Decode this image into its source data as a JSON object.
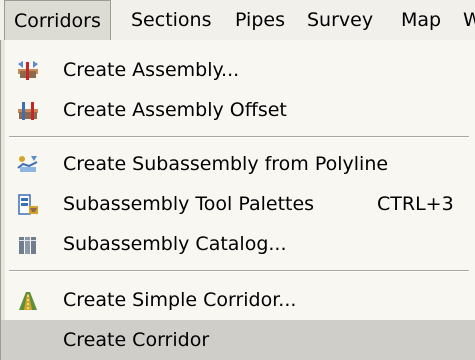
{
  "menubar": {
    "items": [
      {
        "label": "Corridors",
        "active": true
      },
      {
        "label": "Sections"
      },
      {
        "label": "Pipes"
      },
      {
        "label": "Survey"
      },
      {
        "label": "Map"
      },
      {
        "label": "W"
      }
    ]
  },
  "menu": {
    "items": [
      {
        "label": "Create Assembly...",
        "icon": "assembly-icon"
      },
      {
        "label": "Create Assembly Offset",
        "icon": "assembly-offset-icon"
      },
      {
        "label": "Create Subassembly from Polyline",
        "icon": "subassembly-polyline-icon"
      },
      {
        "label": "Subassembly Tool Palettes",
        "shortcut": "CTRL+3",
        "icon": "tool-palettes-icon"
      },
      {
        "label": "Subassembly Catalog...",
        "icon": "catalog-icon"
      },
      {
        "label": "Create Simple Corridor...",
        "icon": "simple-corridor-icon"
      },
      {
        "label": "Create Corridor",
        "highlighted": true
      }
    ]
  },
  "colors": {
    "menu_bg": "#f8f7f2",
    "highlight": "#cfcec8",
    "accent_red": "#c8242a",
    "accent_blue": "#3d6fb6"
  }
}
